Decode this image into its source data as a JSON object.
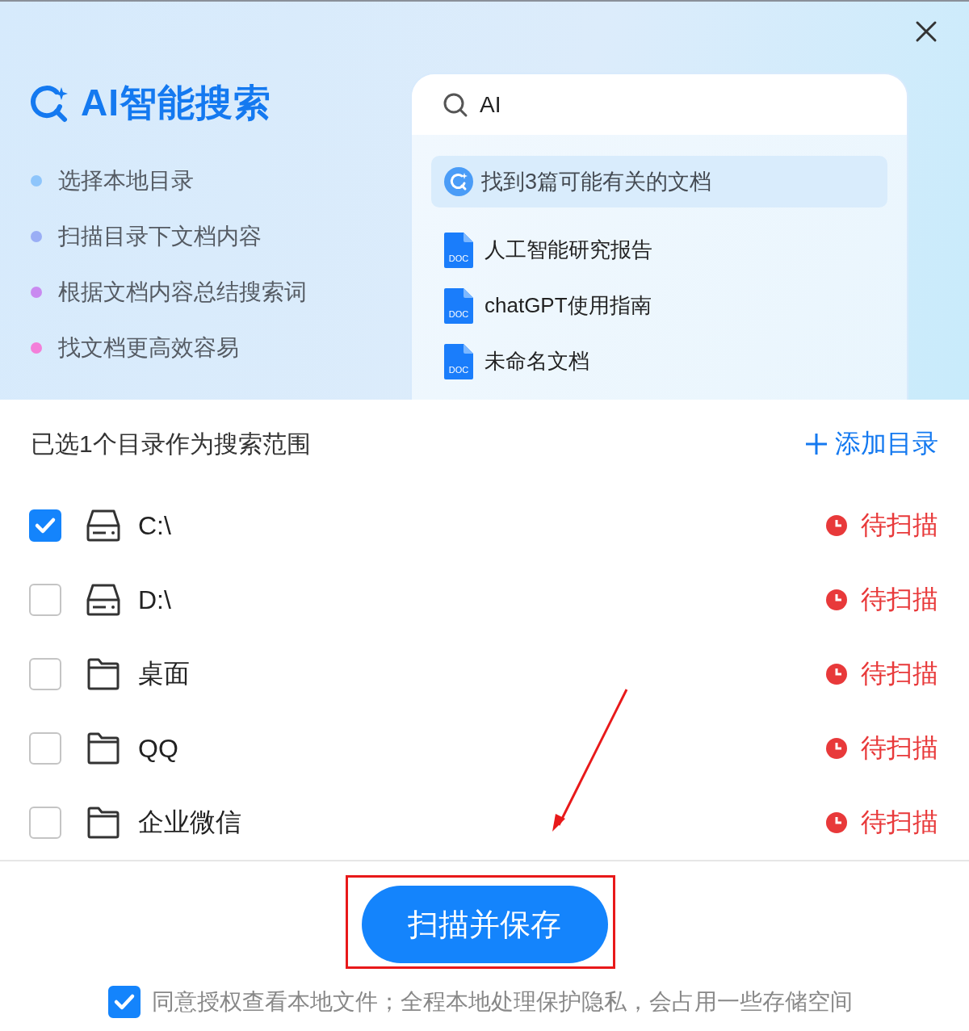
{
  "title": "AI智能搜索",
  "features": [
    {
      "text": "选择本地目录",
      "color": "#8ec5fb"
    },
    {
      "text": "扫描目录下文档内容",
      "color": "#9aaef5"
    },
    {
      "text": "根据文档内容总结搜索词",
      "color": "#c98af0"
    },
    {
      "text": "找文档更高效容易",
      "color": "#f37fd9"
    }
  ],
  "search": {
    "value": "AI"
  },
  "result_banner": "找到3篇可能有关的文档",
  "documents": [
    {
      "name": "人工智能研究报告",
      "badge": "DOC"
    },
    {
      "name": "chatGPT使用指南",
      "badge": "DOC"
    },
    {
      "name": "未命名文档",
      "badge": "DOC"
    }
  ],
  "scope_label": "已选1个目录作为搜索范围",
  "add_button": "添加目录",
  "directories": [
    {
      "name": "C:\\",
      "kind": "drive",
      "checked": true,
      "status": "待扫描"
    },
    {
      "name": "D:\\",
      "kind": "drive",
      "checked": false,
      "status": "待扫描"
    },
    {
      "name": "桌面",
      "kind": "folder",
      "checked": false,
      "status": "待扫描"
    },
    {
      "name": "QQ",
      "kind": "folder",
      "checked": false,
      "status": "待扫描"
    },
    {
      "name": "企业微信",
      "kind": "folder",
      "checked": false,
      "status": "待扫描"
    }
  ],
  "primary_button": "扫描并保存",
  "consent": {
    "text": "同意授权查看本地文件；全程本地处理保护隐私，会占用一些存储空间",
    "checked": true
  }
}
